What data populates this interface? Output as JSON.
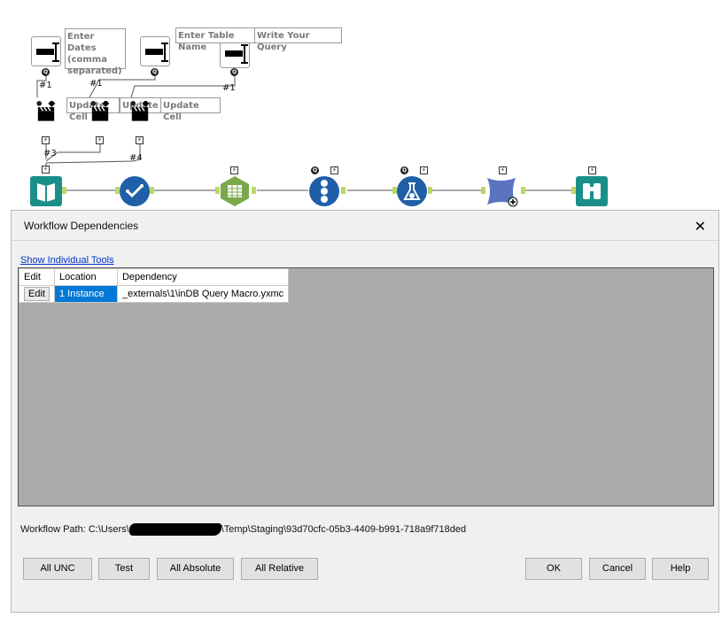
{
  "canvas": {
    "notes": {
      "enter_dates": "Enter Dates (comma separated)",
      "enter_table_name": "Enter Table Name",
      "write_query": "Write Your Query",
      "update_cell_1": "Update Cell",
      "update_cell_2": "Update C",
      "update_cell_3": "Update Cell"
    },
    "labels": {
      "c1": "#1",
      "c2": "#1",
      "c3": "#1",
      "c4": "#3",
      "c5": "#4"
    },
    "icon_anchor_q": "Q",
    "icon_anchor_bolt": "⚡"
  },
  "dialog": {
    "title": "Workflow Dependencies",
    "close": "✕",
    "show_individual_tools": "Show Individual Tools",
    "table": {
      "headers": [
        "Edit",
        "Location",
        "Dependency"
      ],
      "rows": [
        {
          "edit": "Edit",
          "location": "1 Instance",
          "dependency": "_externals\\1\\inDB Query Macro.yxmc"
        }
      ]
    },
    "workflow_path_label": "Workflow Path: C:\\Users\\",
    "workflow_path_rest": "\\Temp\\Staging\\93d70cfc-05b3-4409-b991-718a9f718ded",
    "buttons": {
      "all_unc": "All UNC",
      "test": "Test",
      "all_absolute": "All Absolute",
      "all_relative": "All Relative",
      "ok": "OK",
      "cancel": "Cancel",
      "help": "Help"
    }
  },
  "colors": {
    "selection": "#0078d7",
    "grid_bg": "#ababab",
    "link": "#0033cc",
    "tool_teal": "#1a8f8a",
    "tool_blue": "#1f5fa8",
    "tool_green": "#7aa84a",
    "tool_purple": "#5a74c0"
  }
}
